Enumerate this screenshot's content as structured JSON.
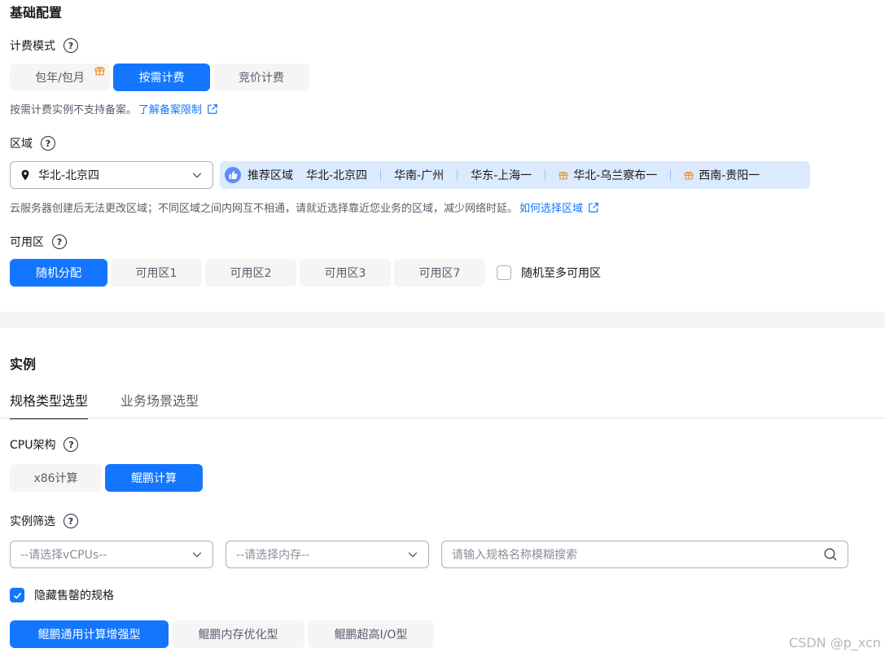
{
  "basic": {
    "title": "基础配置",
    "billing": {
      "label": "计费模式",
      "help": "?",
      "options": [
        "包年/包月",
        "按需计费",
        "竞价计费"
      ],
      "selected": "按需计费",
      "hint": "按需计费实例不支持备案。",
      "hint_link": "了解备案限制"
    },
    "region": {
      "label": "区域",
      "help": "?",
      "value": "华北-北京四",
      "recommend_label": "推荐区域",
      "recommended": [
        "华北-北京四",
        "华南-广州",
        "华东-上海一",
        "华北-乌兰察布一",
        "西南-贵阳一"
      ],
      "hint": "云服务器创建后无法更改区域；不同区域之间内网互不相通，请就近选择靠近您业务的区域，减少网络时延。",
      "hint_link": "如何选择区域"
    },
    "az": {
      "label": "可用区",
      "help": "?",
      "options": [
        "随机分配",
        "可用区1",
        "可用区2",
        "可用区3",
        "可用区7"
      ],
      "selected": "随机分配",
      "checkbox_label": "随机至多可用区"
    }
  },
  "instance": {
    "title": "实例",
    "tabs": [
      "规格类型选型",
      "业务场景选型"
    ],
    "active_tab": "规格类型选型",
    "cpu": {
      "label": "CPU架构",
      "help": "?",
      "options": [
        "x86计算",
        "鲲鹏计算"
      ],
      "selected": "鲲鹏计算"
    },
    "filter": {
      "label": "实例筛选",
      "help": "?",
      "vcpu_placeholder": "--请选择vCPUs--",
      "mem_placeholder": "--请选择内存--",
      "search_placeholder": "请输入规格名称模糊搜索",
      "hide_soldout_label": "隐藏售罄的规格"
    },
    "types": [
      "鲲鹏通用计算增强型",
      "鲲鹏内存优化型",
      "鲲鹏超高I/O型"
    ],
    "selected_type": "鲲鹏通用计算增强型"
  },
  "watermark": "CSDN @p_xcn",
  "colors": {
    "accent": "#1476ff",
    "recommend_bg": "#dbeaff",
    "gift": "#f08a24"
  }
}
